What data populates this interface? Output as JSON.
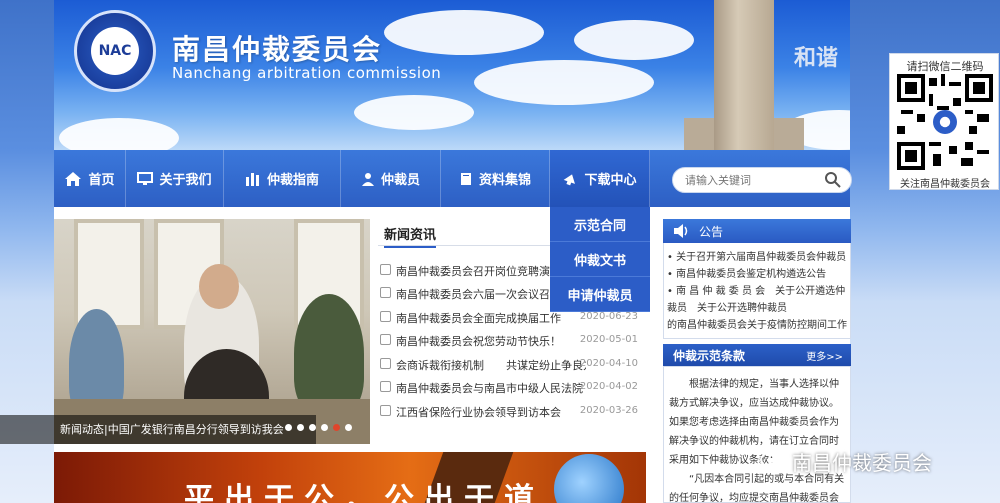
{
  "header": {
    "title": "南昌仲裁委员会",
    "subtitle": "Nanchang arbitration commission",
    "logo_text": "NAC",
    "slogan": "和谐"
  },
  "qr": {
    "title": "请扫微信二维码",
    "footer": "关注南昌仲裁委员会"
  },
  "nav": {
    "items": [
      {
        "label": "首页",
        "icon": "home-icon"
      },
      {
        "label": "关于我们",
        "icon": "monitor-icon"
      },
      {
        "label": "仲裁指南",
        "icon": "bar-chart-icon"
      },
      {
        "label": "仲裁员",
        "icon": "person-icon"
      },
      {
        "label": "资料集锦",
        "icon": "book-icon"
      },
      {
        "label": "下载中心",
        "icon": "download-icon"
      }
    ],
    "search_placeholder": "请输入关键词"
  },
  "dropdown": {
    "items": [
      "示范合同",
      "仲裁文书",
      "申请仲裁员"
    ]
  },
  "slider": {
    "caption": "新闻动态|中国广发银行南昌分行领导到访我会",
    "dots": 6,
    "active_dot": 5
  },
  "news": {
    "title": "新闻资讯",
    "items": [
      {
        "title": "南昌仲裁委员会召开岗位竞聘演讲会",
        "date": ""
      },
      {
        "title": "南昌仲裁委员会六届一次会议召开",
        "date": ""
      },
      {
        "title": "南昌仲裁委员会全面完成换届工作",
        "date": "2020-06-23"
      },
      {
        "title": "南昌仲裁委员会祝您劳动节快乐！",
        "date": "2020-05-01"
      },
      {
        "title": "会商诉裁衔接机制　　共谋定纷止争良方",
        "date": "2020-04-10"
      },
      {
        "title": "南昌仲裁委员会与南昌市中级人民法院　共",
        "date": "2020-04-02"
      },
      {
        "title": "江西省保险行业协会领导到访本会",
        "date": "2020-03-26"
      }
    ]
  },
  "notice": {
    "title": "公告",
    "lines": [
      "• 关于召开第六届南昌仲裁委员会仲裁员",
      "• 南昌仲裁委员会鉴定机构遴选公告",
      "• 南 昌 仲 裁 委 员 会　关于公开遴选仲裁员　关于公开选聘仲裁员",
      "的南昌仲裁委员会关于疫情防控期间工作"
    ]
  },
  "clause": {
    "title": "仲裁示范条款",
    "more": "更多>>",
    "text": "根据法律的规定，当事人选择以仲裁方式解决争议，应当达成仲裁协议。如果您考虑选择由南昌仲裁委员会作为解决争议的仲裁机构，请在订立合同时采用如下仲裁协议条款：",
    "text2": "“凡因本合同引起的或与本合同有关的任何争议，均应提交南昌仲裁委员会按"
  },
  "bottom_banner": {
    "text": "平出于公，公出于道"
  },
  "watermark": "南昌仲裁委员会",
  "colors": {
    "nav_blue": "#2d5fc4",
    "accent_red": "#e0452b"
  }
}
